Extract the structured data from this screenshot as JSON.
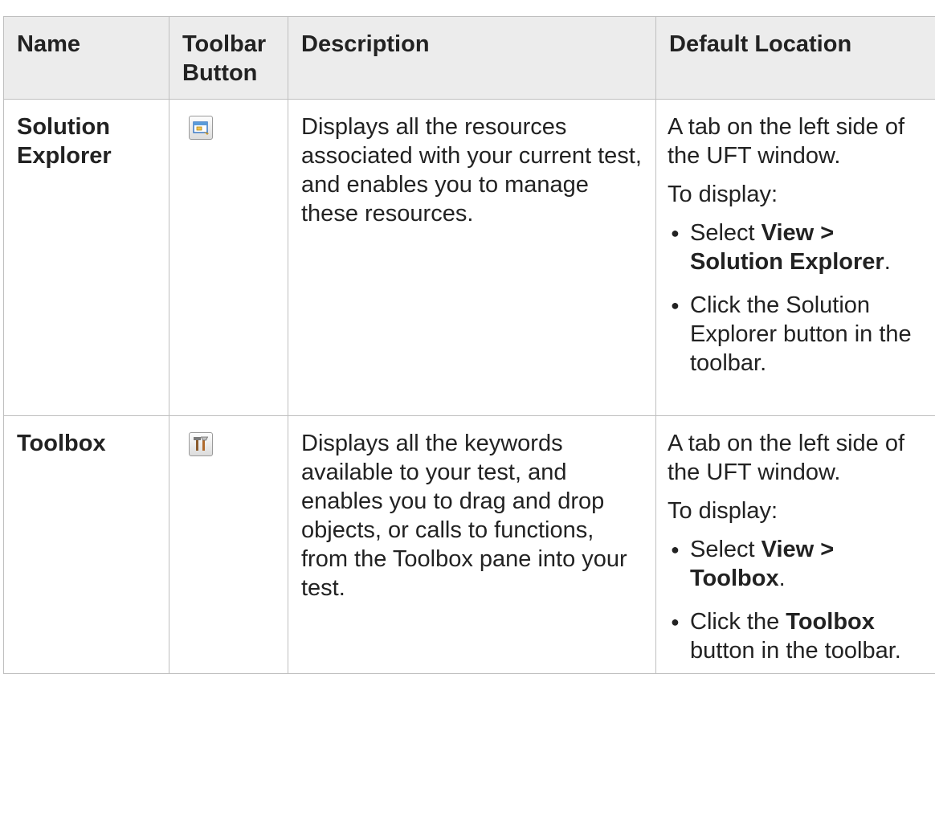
{
  "table": {
    "headers": {
      "name": "Name",
      "button": "Toolbar Button",
      "description": "Description",
      "location": "Default Location"
    },
    "rows": [
      {
        "name": "Solution Explorer",
        "icon": "solution-explorer-icon",
        "description": "Displays all the resources associated with your current test, and enables you to manage these resources.",
        "location_intro": "A tab on the left side of the UFT window.",
        "to_display": "To display:",
        "step1": {
          "prefix": "Select ",
          "bold": "View > Solution Explorer",
          "suffix": "."
        },
        "step2": {
          "text": "Click the Solution Explorer button in the toolbar."
        }
      },
      {
        "name": "Toolbox",
        "icon": "toolbox-icon",
        "description": "Displays all the keywords available to your test, and enables you to drag and drop objects, or calls to functions, from the Toolbox pane into your test.",
        "location_intro": "A tab on the left side of the UFT window.",
        "to_display": "To display:",
        "step1": {
          "prefix": "Select ",
          "bold": "View > Toolbox",
          "suffix": "."
        },
        "step2": {
          "prefix": "Click the ",
          "bold": "Toolbox",
          "suffix": " button in the toolbar."
        }
      }
    ]
  },
  "bullet_glyph": "●"
}
